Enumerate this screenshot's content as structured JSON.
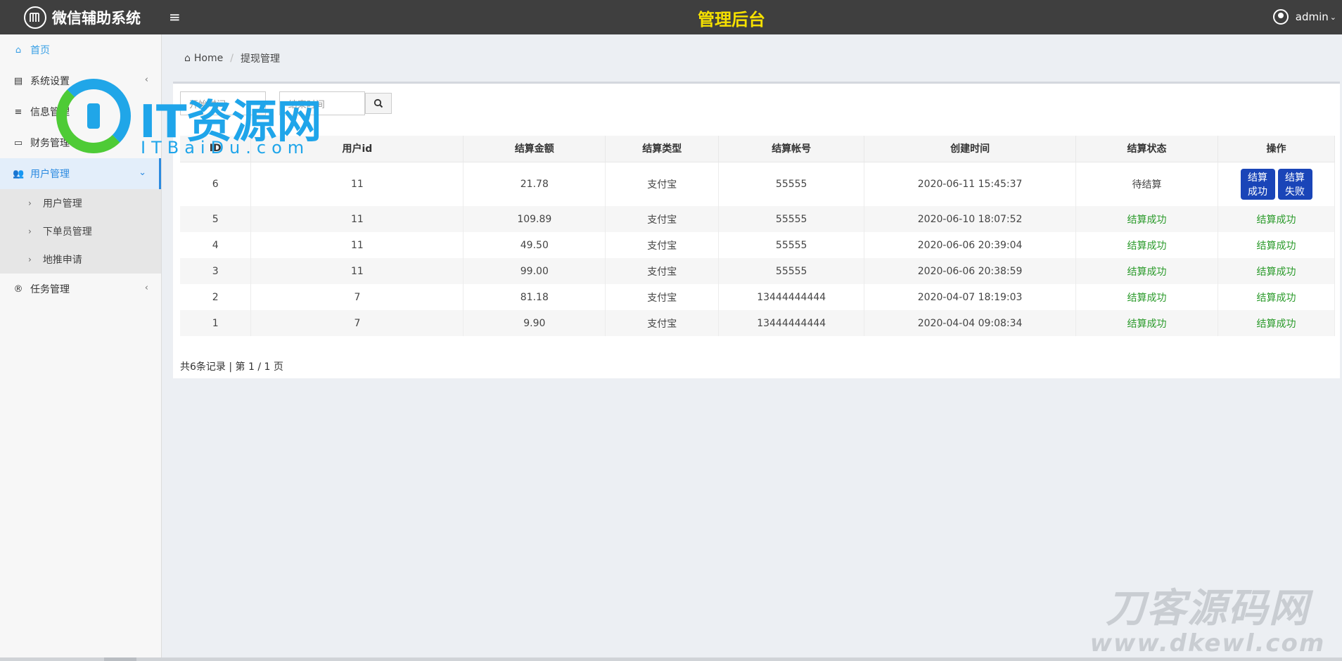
{
  "header": {
    "brand": "微信辅助系统",
    "menu_toggle": "≡",
    "title": "管理后台",
    "user": "admin"
  },
  "sidebar": {
    "items": [
      {
        "label": "首页",
        "icon": "home-icon"
      },
      {
        "label": "系统设置",
        "icon": "server-icon"
      },
      {
        "label": "信息管理",
        "icon": "list-icon"
      },
      {
        "label": "财务管理",
        "icon": "money-icon"
      },
      {
        "label": "用户管理",
        "icon": "users-icon"
      },
      {
        "label": "任务管理",
        "icon": "registered-icon"
      }
    ],
    "sub_items": [
      {
        "label": "用户管理"
      },
      {
        "label": "下单员管理"
      },
      {
        "label": "地推申请"
      }
    ]
  },
  "breadcrumb": {
    "home": "Home",
    "current": "提现管理"
  },
  "filter": {
    "start_placeholder": "开始时间",
    "dash": "-",
    "end_placeholder": "结束时间"
  },
  "table": {
    "headers": [
      "ID",
      "用户id",
      "结算金额",
      "结算类型",
      "结算帐号",
      "创建时间",
      "结算状态",
      "操作"
    ],
    "rows": [
      {
        "id": "6",
        "uid": "11",
        "amount": "21.78",
        "type": "支付宝",
        "account": "55555",
        "time": "2020-06-11 15:45:37",
        "status": "待结算",
        "op": ""
      },
      {
        "id": "5",
        "uid": "11",
        "amount": "109.89",
        "type": "支付宝",
        "account": "55555",
        "time": "2020-06-10 18:07:52",
        "status": "结算成功",
        "op": "结算成功"
      },
      {
        "id": "4",
        "uid": "11",
        "amount": "49.50",
        "type": "支付宝",
        "account": "55555",
        "time": "2020-06-06 20:39:04",
        "status": "结算成功",
        "op": "结算成功"
      },
      {
        "id": "3",
        "uid": "11",
        "amount": "99.00",
        "type": "支付宝",
        "account": "55555",
        "time": "2020-06-06 20:38:59",
        "status": "结算成功",
        "op": "结算成功"
      },
      {
        "id": "2",
        "uid": "7",
        "amount": "81.18",
        "type": "支付宝",
        "account": "13444444444",
        "time": "2020-04-07 18:19:03",
        "status": "结算成功",
        "op": "结算成功"
      },
      {
        "id": "1",
        "uid": "7",
        "amount": "9.90",
        "type": "支付宝",
        "account": "13444444444",
        "time": "2020-04-04 09:08:34",
        "status": "结算成功",
        "op": "结算成功"
      }
    ],
    "action_success": "结算\n成功",
    "action_fail": "结算\n失败"
  },
  "pager": "共6条记录 | 第 1 / 1 页",
  "watermarks": {
    "it_main": "IT资源网",
    "it_sub": "ITBaiDu.com",
    "dk_main": "刀客源码网",
    "dk_sub": "www.dkewl.com"
  },
  "colors": {
    "topbar": "#3f3f3f",
    "title": "#f5e000",
    "accent": "#2b8ae0",
    "button": "#1a45b8",
    "success": "#2a9a2a"
  }
}
